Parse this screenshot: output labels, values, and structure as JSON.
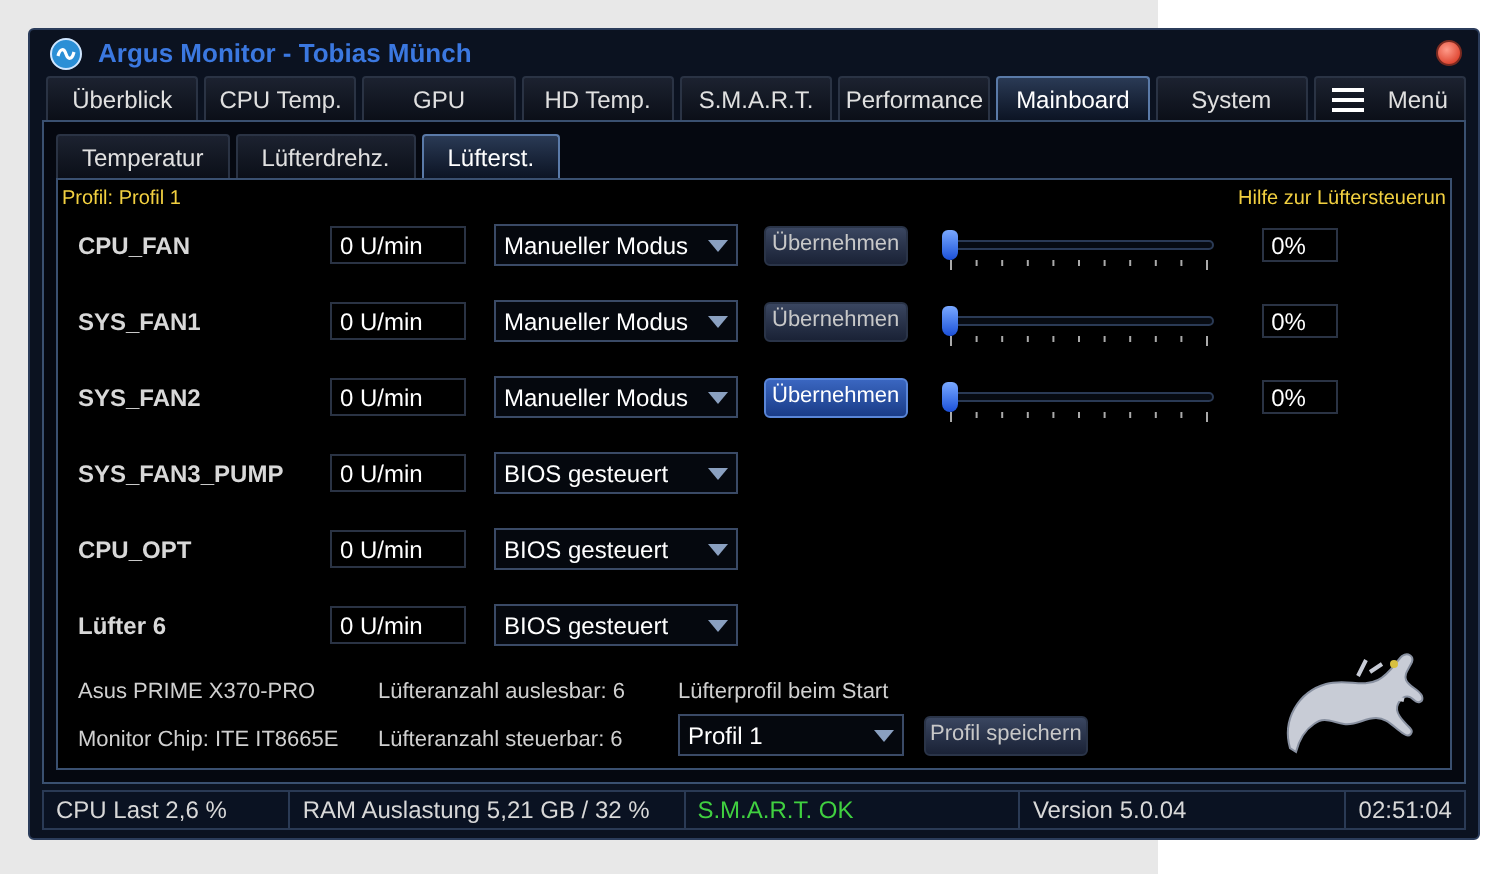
{
  "window": {
    "title": "Argus Monitor - Tobias Münch"
  },
  "tabs": [
    {
      "label": "Überblick",
      "selected": false
    },
    {
      "label": "CPU Temp.",
      "selected": false
    },
    {
      "label": "GPU",
      "selected": false
    },
    {
      "label": "HD Temp.",
      "selected": false
    },
    {
      "label": "S.M.A.R.T.",
      "selected": false
    },
    {
      "label": "Performance",
      "selected": false
    },
    {
      "label": "Mainboard",
      "selected": true
    },
    {
      "label": "System",
      "selected": false
    },
    {
      "label": "Menü",
      "selected": false,
      "kind": "menu"
    }
  ],
  "subtabs": [
    {
      "label": "Temperatur",
      "selected": false
    },
    {
      "label": "Lüfterdrehz.",
      "selected": false
    },
    {
      "label": "Lüfterst.",
      "selected": true
    }
  ],
  "profile_label": "Profil: Profil 1",
  "help_link": "Hilfe zur Lüftersteuerun",
  "fans": [
    {
      "name": "CPU_FAN",
      "rpm": "0 U/min",
      "mode": "Manueller Modus",
      "kind": "manual",
      "button": "Übernehmen",
      "highlighted": false,
      "level": 0,
      "percent": "0%"
    },
    {
      "name": "SYS_FAN1",
      "rpm": "0 U/min",
      "mode": "Manueller Modus",
      "kind": "manual",
      "button": "Übernehmen",
      "highlighted": false,
      "level": 0,
      "percent": "0%"
    },
    {
      "name": "SYS_FAN2",
      "rpm": "0 U/min",
      "mode": "Manueller Modus",
      "kind": "manual",
      "button": "Übernehmen",
      "highlighted": true,
      "level": 0,
      "percent": "0%"
    },
    {
      "name": "SYS_FAN3_PUMP",
      "rpm": "0 U/min",
      "mode": "BIOS gesteuert",
      "kind": "bios"
    },
    {
      "name": "CPU_OPT",
      "rpm": "0 U/min",
      "mode": "BIOS gesteuert",
      "kind": "bios"
    },
    {
      "name": "Lüfter 6",
      "rpm": "0 U/min",
      "mode": "BIOS gesteuert",
      "kind": "bios"
    }
  ],
  "info": {
    "board": "Asus PRIME X370-PRO",
    "chip": "Monitor Chip: ITE IT8665E",
    "readable": "Lüfteranzahl auslesbar: 6",
    "controllable": "Lüfteranzahl steuerbar: 6",
    "startup_label": "Lüfterprofil beim Start",
    "startup_profile": "Profil 1",
    "save_button": "Profil speichern"
  },
  "status_bar": [
    {
      "text": "CPU Last 2,6 %",
      "kind": "normal"
    },
    {
      "text": "RAM Auslastung 5,21 GB / 32 %",
      "kind": "normal"
    },
    {
      "text": "S.M.A.R.T. OK",
      "kind": "ok"
    },
    {
      "text": "Version 5.0.04",
      "kind": "normal"
    },
    {
      "text": "02:51:04",
      "kind": "normal"
    }
  ]
}
